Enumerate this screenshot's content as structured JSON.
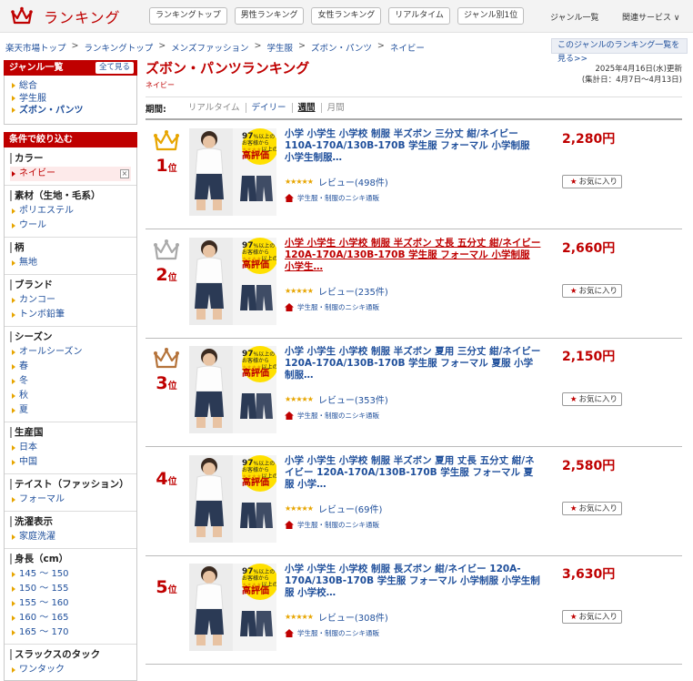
{
  "header": {
    "logo_text": "ランキング",
    "tabs": [
      "ランキングトップ",
      "男性ランキング",
      "女性ランキング",
      "リアルタイム",
      "ジャンル別1位"
    ],
    "genre_list": "ジャンル一覧",
    "related": "関連サービス ∨"
  },
  "breadcrumb": [
    "楽天市場トップ",
    "ランキングトップ",
    "メンズファッション",
    "学生服",
    "ズボン・パンツ",
    "ネイビー"
  ],
  "genre_link": "このジャンルのランキング一覧を見る>>",
  "sidebar": {
    "genre_title": "ジャンル一覧",
    "see_all": "全て見る",
    "genres": [
      "総合",
      "学生服",
      "ズボン・パンツ"
    ],
    "filter_title": "条件で絞り込む",
    "groups": [
      {
        "title": "カラー",
        "items": [
          "ネイビー"
        ]
      },
      {
        "title": "素材（生地・毛系）",
        "items": [
          "ポリエステル",
          "ウール"
        ]
      },
      {
        "title": "柄",
        "items": [
          "無地"
        ]
      },
      {
        "title": "ブランド",
        "items": [
          "カンコー",
          "トンボ鉛筆"
        ]
      },
      {
        "title": "シーズン",
        "items": [
          "オールシーズン",
          "春",
          "冬",
          "秋",
          "夏"
        ]
      },
      {
        "title": "生産国",
        "items": [
          "日本",
          "中国"
        ]
      },
      {
        "title": "テイスト（ファッション）",
        "items": [
          "フォーマル"
        ]
      },
      {
        "title": "洗濯表示",
        "items": [
          "家庭洗濯"
        ]
      },
      {
        "title": "身長（cm）",
        "items": [
          "145 〜 150",
          "150 〜 155",
          "155 〜 160",
          "160 〜 165",
          "165 〜 170"
        ]
      },
      {
        "title": "スラックスのタック",
        "items": [
          "ワンタック"
        ]
      }
    ]
  },
  "page": {
    "title": "ズボン・パンツランキング",
    "subtitle": "ネイビー",
    "updated": "2025年4月16日(水)更新",
    "period_range": "(集計日：4月7日〜4月13日)",
    "period_label": "期間:",
    "periods": [
      "リアルタイム",
      "デイリー",
      "週間",
      "月間"
    ]
  },
  "items": [
    {
      "rank": "1",
      "suffix": "位",
      "name": "小学 小学生 小学校 制服 半ズボン 三分丈 紺/ネイビー 110A-170A/130B-170B 学生服 フォーマル 小学制服 小学生制服…",
      "stars": "★★★★★",
      "reviews": "レビュー(498件)",
      "shop": "学生服・制服のニシキ通販",
      "price": "2,280円",
      "fav": "お気に入り"
    },
    {
      "rank": "2",
      "suffix": "位",
      "name": "小学 小学生 小学校 制服 半ズボン 丈長 五分丈 紺/ネイビー 120A-170A/130B-170B 学生服 フォーマル 小学制服 小学生…",
      "stars": "★★★★★",
      "reviews": "レビュー(235件)",
      "shop": "学生服・制服のニシキ通販",
      "price": "2,660円",
      "fav": "お気に入り"
    },
    {
      "rank": "3",
      "suffix": "位",
      "name": "小学 小学生 小学校 制服 半ズボン 夏用 三分丈 紺/ネイビー 120A-170A/130B-170B 学生服 フォーマル 夏服 小学制服…",
      "stars": "★★★★★",
      "reviews": "レビュー(353件)",
      "shop": "学生服・制服のニシキ通販",
      "price": "2,150円",
      "fav": "お気に入り"
    },
    {
      "rank": "4",
      "suffix": "位",
      "name": "小学 小学生 小学校 制服 半ズボン 夏用 丈長 五分丈 紺/ネイビー 120A-170A/130B-170B 学生服 フォーマル 夏服 小学…",
      "stars": "★★★★★",
      "reviews": "レビュー(69件)",
      "shop": "学生服・制服のニシキ通販",
      "price": "2,580円",
      "fav": "お気に入り"
    },
    {
      "rank": "5",
      "suffix": "位",
      "name": "小学 小学生 小学校 制服 長ズボン 紺/ネイビー 120A-170A/130B-170B 学生服 フォーマル 小学制服 小学生制服 小学校…",
      "stars": "★★★★★",
      "reviews": "レビュー(308件)",
      "shop": "学生服・制服のニシキ通販",
      "price": "3,630円",
      "fav": "お気に入り"
    }
  ],
  "badge": {
    "line1": "97",
    "line2": "%以上の",
    "line3": "お客様から",
    "line4": "★★★★",
    "line5": "以上の",
    "line6": "高評価"
  },
  "colors": {
    "brand_red": "#bf0000",
    "link_blue": "#1f4f9b",
    "gold": "#e7a500",
    "silver": "#a9a9a9",
    "bronze": "#b5733a"
  }
}
